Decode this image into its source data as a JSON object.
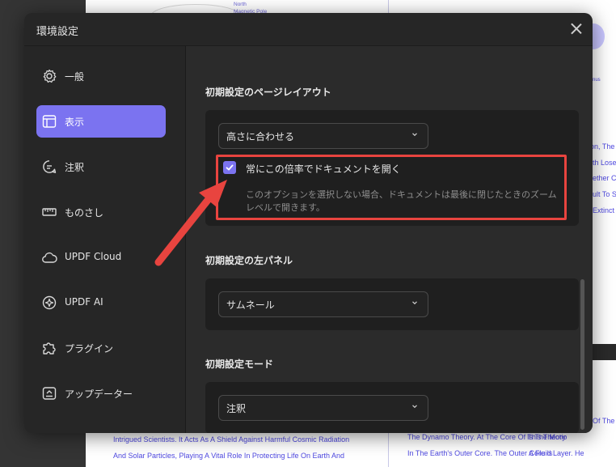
{
  "background": {
    "top_label_lines": [
      "North",
      "Magnetic Pole"
    ],
    "right_fragments": [
      "nus",
      "on, The",
      "th Lose",
      "ether C",
      "ult To S",
      "Extinct",
      "Of The",
      "Is The Motio",
      "A Fluid Layer. He"
    ],
    "bottom_left_lines": [
      "Intrigued Scientists. It Acts As A Shield Against Harmful Cosmic Radiation",
      "And Solar Particles, Playing A Vital Role In Protecting Life On Earth And"
    ],
    "bottom_right_lines": [
      "The Dynamo Theory. At The Core Of This Theory",
      "In The Earth's Outer Core. The Outer Core Is"
    ]
  },
  "dialog": {
    "title": "環境設定",
    "close_icon": "close-icon"
  },
  "sidebar": {
    "items": [
      {
        "label": "一般",
        "icon": "gear-icon",
        "active": false
      },
      {
        "label": "表示",
        "icon": "layout-icon",
        "active": true
      },
      {
        "label": "注釈",
        "icon": "comment-icon",
        "active": false
      },
      {
        "label": "ものさし",
        "icon": "ruler-icon",
        "active": false
      },
      {
        "label": "UPDF Cloud",
        "icon": "cloud-icon",
        "active": false
      },
      {
        "label": "UPDF AI",
        "icon": "ai-icon",
        "active": false
      },
      {
        "label": "プラグイン",
        "icon": "puzzle-icon",
        "active": false
      },
      {
        "label": "アップデーター",
        "icon": "update-icon",
        "active": false
      }
    ]
  },
  "main": {
    "page_layout": {
      "title": "初期設定のページレイアウト",
      "selected": "高さに合わせる",
      "checkbox_label": "常にこの倍率でドキュメントを開く",
      "checkbox_checked": true,
      "description": "このオプションを選択しない場合、ドキュメントは最後に閉じたときのズームレベルで開きます。"
    },
    "left_panel": {
      "title": "初期設定の左パネル",
      "selected": "サムネール"
    },
    "mode": {
      "title": "初期設定モード",
      "selected": "注釈"
    }
  },
  "colors": {
    "accent": "#7b73f0",
    "annotation_red": "#e8443f"
  }
}
